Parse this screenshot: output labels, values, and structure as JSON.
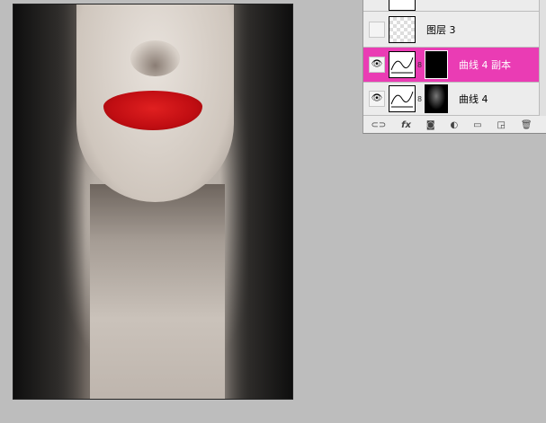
{
  "layers": [
    {
      "name": "图层 3",
      "visible": false,
      "selected": false,
      "type": "pixel"
    },
    {
      "name": "曲线 4 副本",
      "visible": true,
      "selected": true,
      "type": "curves"
    },
    {
      "name": "曲线 4",
      "visible": true,
      "selected": false,
      "type": "curves"
    }
  ],
  "footer_icons": [
    "link-icon",
    "fx-icon",
    "mask-icon",
    "adjustment-icon",
    "folder-icon",
    "new-layer-icon",
    "trash-icon"
  ],
  "footer_labels": {
    "fx": "fx"
  },
  "colors": {
    "selected": "#ea3cb4",
    "canvas": "#bdbdbd"
  }
}
